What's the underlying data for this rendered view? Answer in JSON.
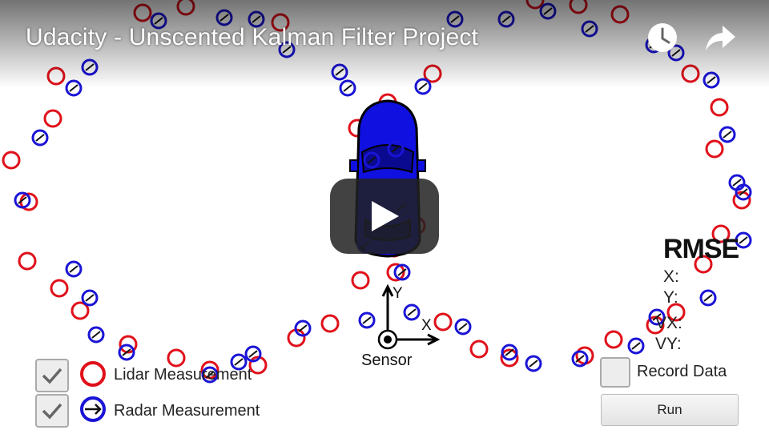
{
  "video": {
    "title": "Udacity - Unscented Kalman Filter Project",
    "watch_later_icon": "clock-icon",
    "share_icon": "share-arrow-icon",
    "play_icon": "play-icon"
  },
  "legend": {
    "lidar": {
      "label": "Lidar Measurement",
      "checked": true,
      "color": "#e0101a"
    },
    "radar": {
      "label": "Radar Measurement",
      "checked": true,
      "color": "#1a14d6"
    }
  },
  "controls": {
    "record_label": "Record Data",
    "record_checked": false,
    "run_label": "Run"
  },
  "rmse": {
    "title": "RMSE",
    "rows": [
      "X:",
      "Y:",
      "VX:",
      "VY:"
    ]
  },
  "axes": {
    "sensor_label": "Sensor",
    "x_label": "X",
    "y_label": "Y"
  },
  "colors": {
    "lidar": "#e0101a",
    "radar": "#1a14d6",
    "car": "#1010e0"
  }
}
